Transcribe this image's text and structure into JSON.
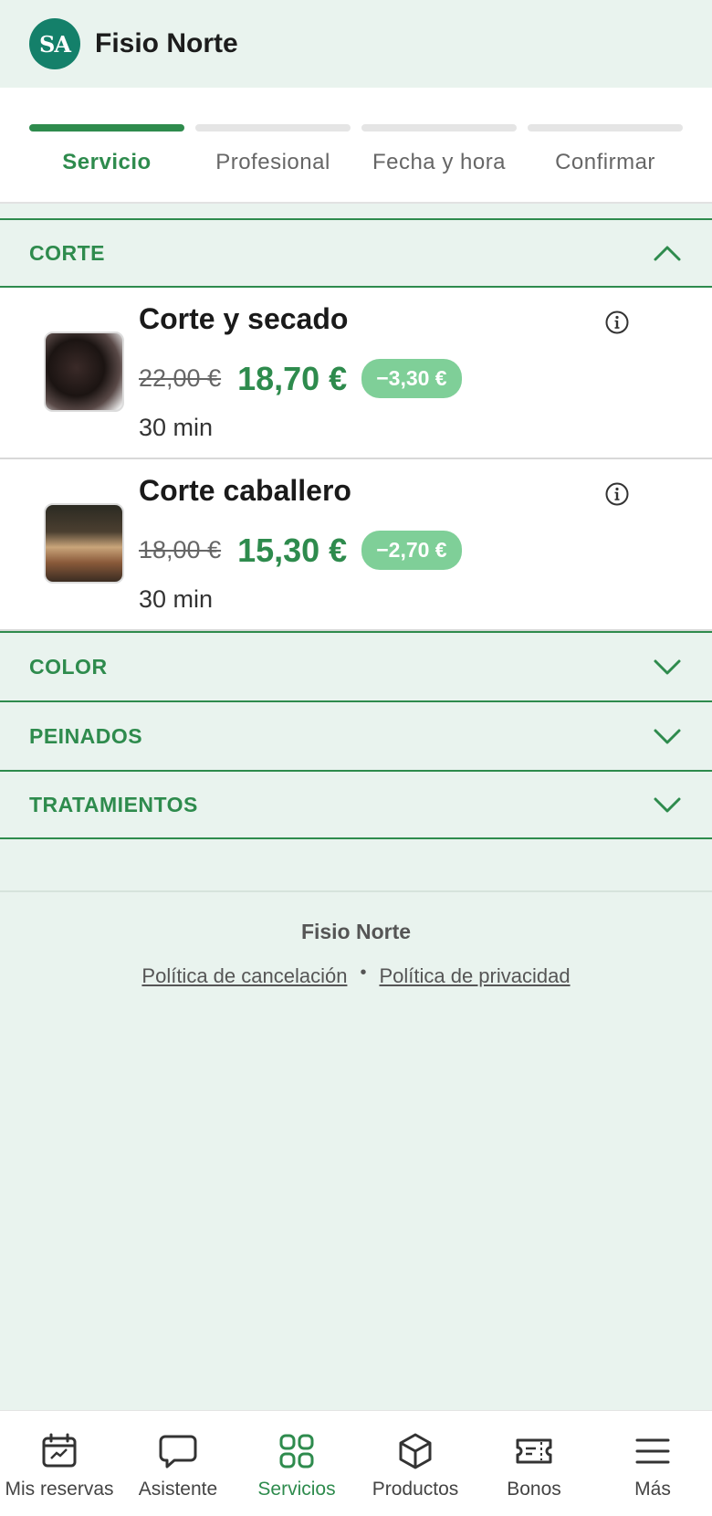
{
  "header": {
    "avatar_text": "SA",
    "title": "Fisio Norte"
  },
  "stepper": {
    "steps": [
      {
        "label": "Servicio",
        "active": true
      },
      {
        "label": "Profesional",
        "active": false
      },
      {
        "label": "Fecha y hora",
        "active": false
      },
      {
        "label": "Confirmar",
        "active": false
      }
    ]
  },
  "categories": [
    {
      "title": "CORTE",
      "expanded": true,
      "services": [
        {
          "name": "Corte y secado",
          "old_price": "22,00 €",
          "price": "18,70 €",
          "discount": "−3,30 €",
          "duration": "30 min"
        },
        {
          "name": "Corte caballero",
          "old_price": "18,00 €",
          "price": "15,30 €",
          "discount": "−2,70 €",
          "duration": "30 min"
        }
      ]
    },
    {
      "title": "COLOR",
      "expanded": false
    },
    {
      "title": "PEINADOS",
      "expanded": false
    },
    {
      "title": "TRATAMIENTOS",
      "expanded": false
    }
  ],
  "footer": {
    "name": "Fisio Norte",
    "cancel_link": "Política de cancelación",
    "separator": "•",
    "privacy_link": "Política de privacidad"
  },
  "bottom_nav": [
    {
      "label": "Mis reservas",
      "icon": "calendar-icon",
      "active": false
    },
    {
      "label": "Asistente",
      "icon": "chat-icon",
      "active": false
    },
    {
      "label": "Servicios",
      "icon": "grid-icon",
      "active": true
    },
    {
      "label": "Productos",
      "icon": "box-icon",
      "active": false
    },
    {
      "label": "Bonos",
      "icon": "ticket-icon",
      "active": false
    },
    {
      "label": "Más",
      "icon": "menu-icon",
      "active": false
    }
  ],
  "colors": {
    "accent": "#2e8b4d",
    "background": "#e9f3ee",
    "badge": "#7fcf98",
    "avatar": "#14806a"
  }
}
